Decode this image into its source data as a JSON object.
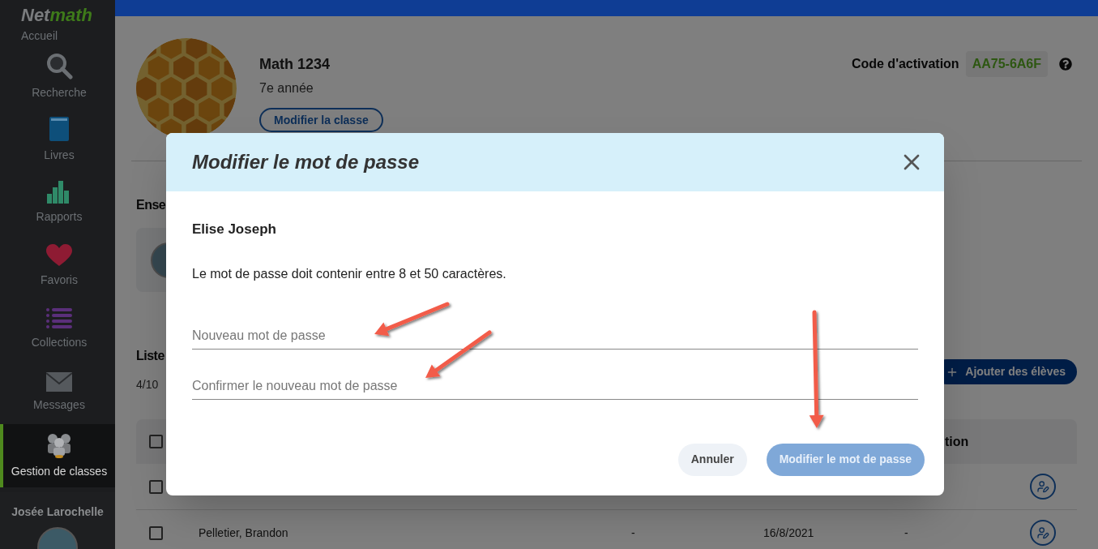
{
  "sidebar": {
    "logo": [
      "Net",
      "math"
    ],
    "home": "Accueil",
    "items": [
      {
        "label": "Recherche",
        "selected": false
      },
      {
        "label": "Livres",
        "selected": false
      },
      {
        "label": "Rapports",
        "selected": false
      },
      {
        "label": "Favoris",
        "selected": false
      },
      {
        "label": "Collections",
        "selected": false
      },
      {
        "label": "Messages",
        "selected": false
      },
      {
        "label": "Gestion de classes",
        "selected": true
      }
    ],
    "user": "Josée Larochelle"
  },
  "class": {
    "title": "Math 1234",
    "grade": "7e année",
    "edit_button": "Modifier la classe",
    "activation_label": "Code d'activation",
    "activation_code": "AA75-6A6F"
  },
  "teachers_heading": "Ense",
  "students_heading": "Liste",
  "students_count": "4/10",
  "add_button": "Ajouter des élèves",
  "table": {
    "header": {
      "checked": false,
      "column_6": "tion"
    },
    "rows": [
      {
        "checked": false,
        "cells": []
      },
      {
        "checked": false,
        "cells": [
          "Pelletier, Brandon",
          "-",
          "16/8/2021",
          "-"
        ]
      }
    ]
  },
  "modal": {
    "title": "Modifier le mot de passe",
    "student": "Elise Joseph",
    "hint": "Le mot de passe doit contenir entre 8 et 50 caractères.",
    "fields": [
      {
        "placeholder": "Nouveau mot de passe"
      },
      {
        "placeholder": "Confirmer le nouveau mot de passe"
      }
    ],
    "buttons": [
      {
        "label": "Annuler",
        "kind": "secondary",
        "disabled": false
      },
      {
        "label": "Modifier le mot de passe",
        "kind": "primary",
        "disabled": true
      }
    ]
  }
}
